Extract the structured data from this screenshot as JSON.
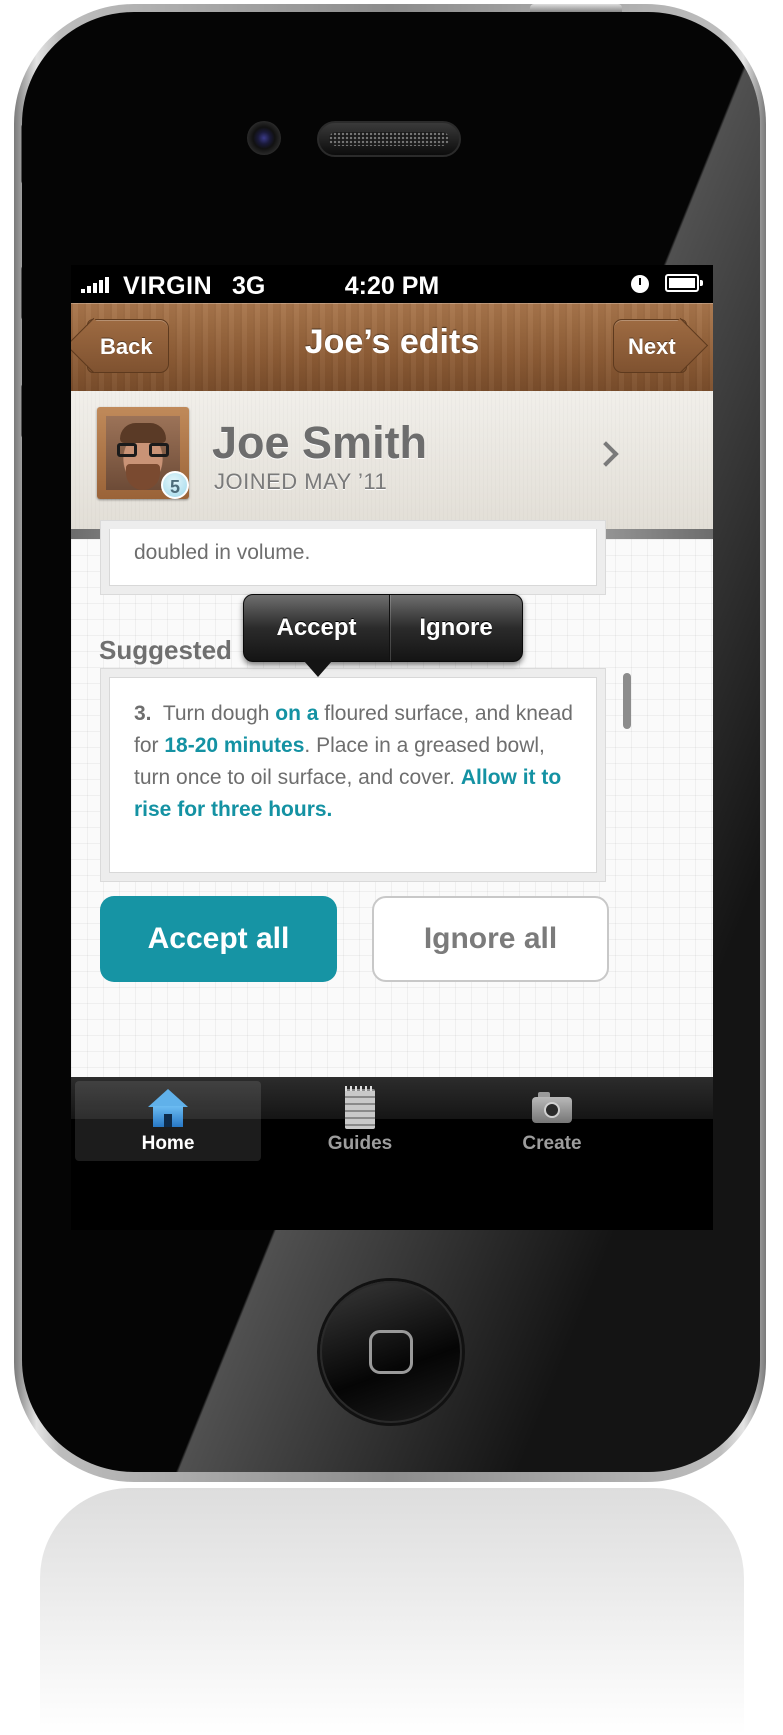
{
  "status_bar": {
    "carrier": "VIRGIN",
    "network": "3G",
    "time": "4:20 PM"
  },
  "nav": {
    "back_label": "Back",
    "title": "Joe’s edits",
    "next_label": "Next"
  },
  "profile": {
    "name": "Joe Smith",
    "joined": "JOINED MAY ’11",
    "badge_count": "5"
  },
  "previous_step": {
    "text": "doubled in volume."
  },
  "suggested": {
    "label": "Suggested",
    "step_number": "3.",
    "segments": [
      {
        "text": "Turn dough ",
        "highlight": false
      },
      {
        "text": "on a",
        "highlight": true
      },
      {
        "text": " floured surface, and knead for ",
        "highlight": false
      },
      {
        "text": "18-20 minutes",
        "highlight": true
      },
      {
        "text": ". Place in a greased bowl, turn once to oil surface, and cover. ",
        "highlight": false
      },
      {
        "text": "Allow it to rise for three hours.",
        "highlight": true
      }
    ]
  },
  "popover": {
    "accept_label": "Accept",
    "ignore_label": "Ignore"
  },
  "actions": {
    "accept_all": "Accept all",
    "ignore_all": "Ignore all"
  },
  "tabs": [
    {
      "label": "Home",
      "icon": "home-icon",
      "active": true
    },
    {
      "label": "Guides",
      "icon": "notepad-icon",
      "active": false
    },
    {
      "label": "Create",
      "icon": "camera-icon",
      "active": false
    }
  ],
  "colors": {
    "accent": "#1694a4",
    "nav_wood": "#8e5d36",
    "highlight_text": "#1492a3"
  }
}
